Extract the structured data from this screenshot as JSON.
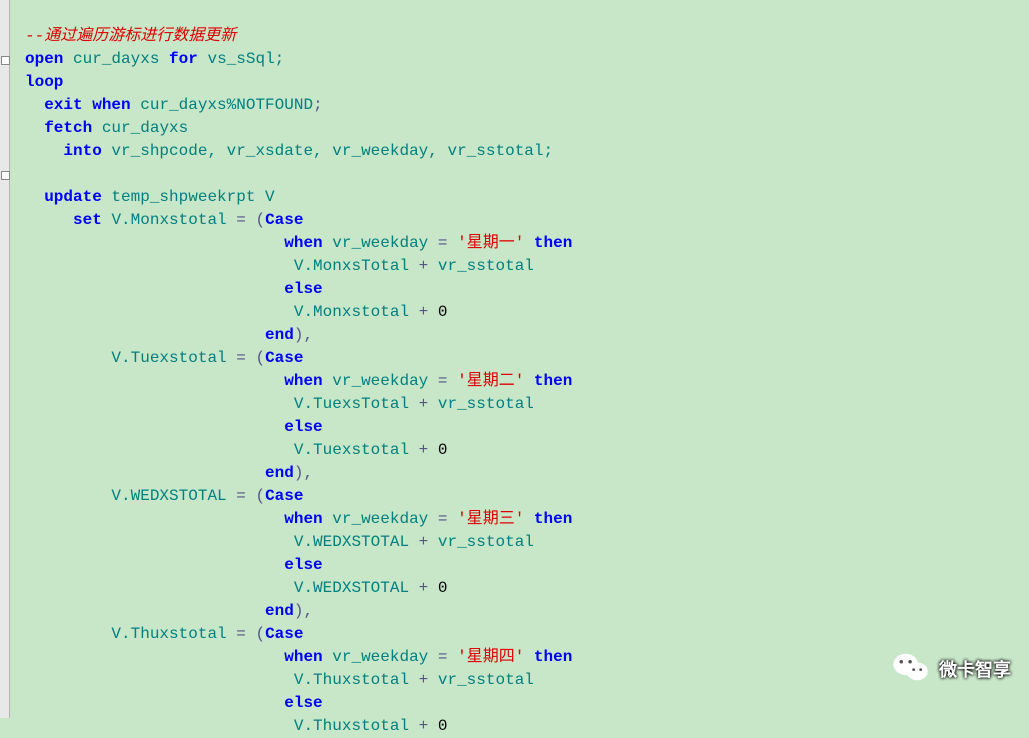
{
  "code": {
    "comment": "--通过遍历游标进行数据更新",
    "open_kw": "open",
    "open_cursor": "cur_dayxs",
    "for_kw": "for",
    "open_var": "vs_sSql;",
    "loop_kw": "loop",
    "exit_kw": "exit",
    "when_kw": "when",
    "exit_cond": "cur_dayxs%NOTFOUND",
    "fetch_kw": "fetch",
    "fetch_cursor": "cur_dayxs",
    "into_kw": "into",
    "into_list": "vr_shpcode, vr_xsdate, vr_weekday, vr_sstotal;",
    "update_kw": "update",
    "update_table": "temp_shpweekrpt V",
    "set_kw": "set",
    "case_kw": "Case",
    "when_case_kw": "when",
    "then_kw": "then",
    "else_kw": "else",
    "end_kw": "end",
    "weekday_var": "vr_weekday",
    "sstotal_var": "vr_sstotal",
    "zero": "0",
    "plus": " + ",
    "eq": " = ",
    "comma_close": "),",
    "mon": {
      "target": "V.Monxstotal",
      "day": "'星期一'",
      "total_true": "V.MonxsTotal",
      "total_false": "V.Monxstotal"
    },
    "tue": {
      "target": "V.Tuexstotal",
      "day": "'星期二'",
      "total_true": "V.TuexsTotal",
      "total_false": "V.Tuexstotal"
    },
    "wed": {
      "target": "V.WEDXSTOTAL",
      "day": "'星期三'",
      "total_true": "V.WEDXSTOTAL",
      "total_false": "V.WEDXSTOTAL"
    },
    "thu": {
      "target": "V.Thuxstotal",
      "day": "'星期四'",
      "total_true": "V.Thuxstotal",
      "total_false": "V.Thuxstotal"
    }
  },
  "watermark": {
    "text": "微卡智享"
  }
}
